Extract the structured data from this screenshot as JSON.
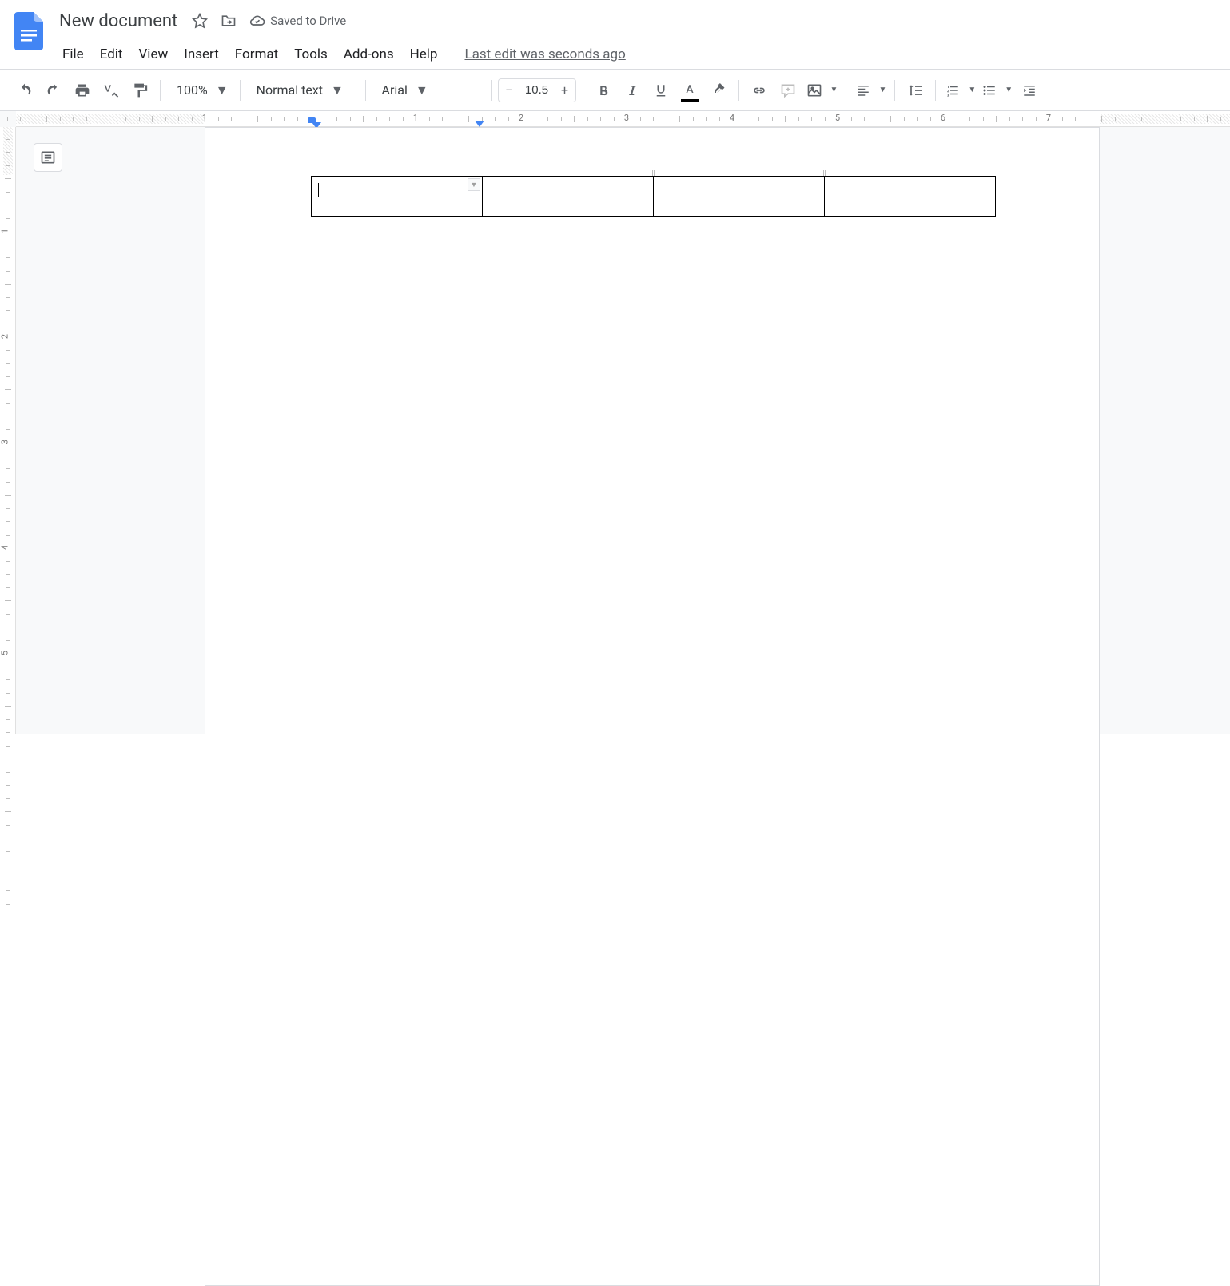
{
  "document": {
    "title": "New document",
    "saved_status": "Saved to Drive",
    "last_edit": "Last edit was seconds ago"
  },
  "menus": {
    "file": "File",
    "edit": "Edit",
    "view": "View",
    "insert": "Insert",
    "format": "Format",
    "tools": "Tools",
    "addons": "Add-ons",
    "help": "Help"
  },
  "toolbar": {
    "zoom": "100%",
    "style": "Normal text",
    "font": "Arial",
    "font_size": "10.5"
  },
  "ruler": {
    "h_labels": [
      "1",
      "1",
      "2",
      "3",
      "4",
      "5",
      "6",
      "7"
    ],
    "v_labels": [
      "1",
      "2",
      "3",
      "4",
      "5"
    ]
  },
  "table": {
    "rows": 1,
    "cols": 4,
    "cells": [
      "",
      "",
      "",
      ""
    ]
  }
}
